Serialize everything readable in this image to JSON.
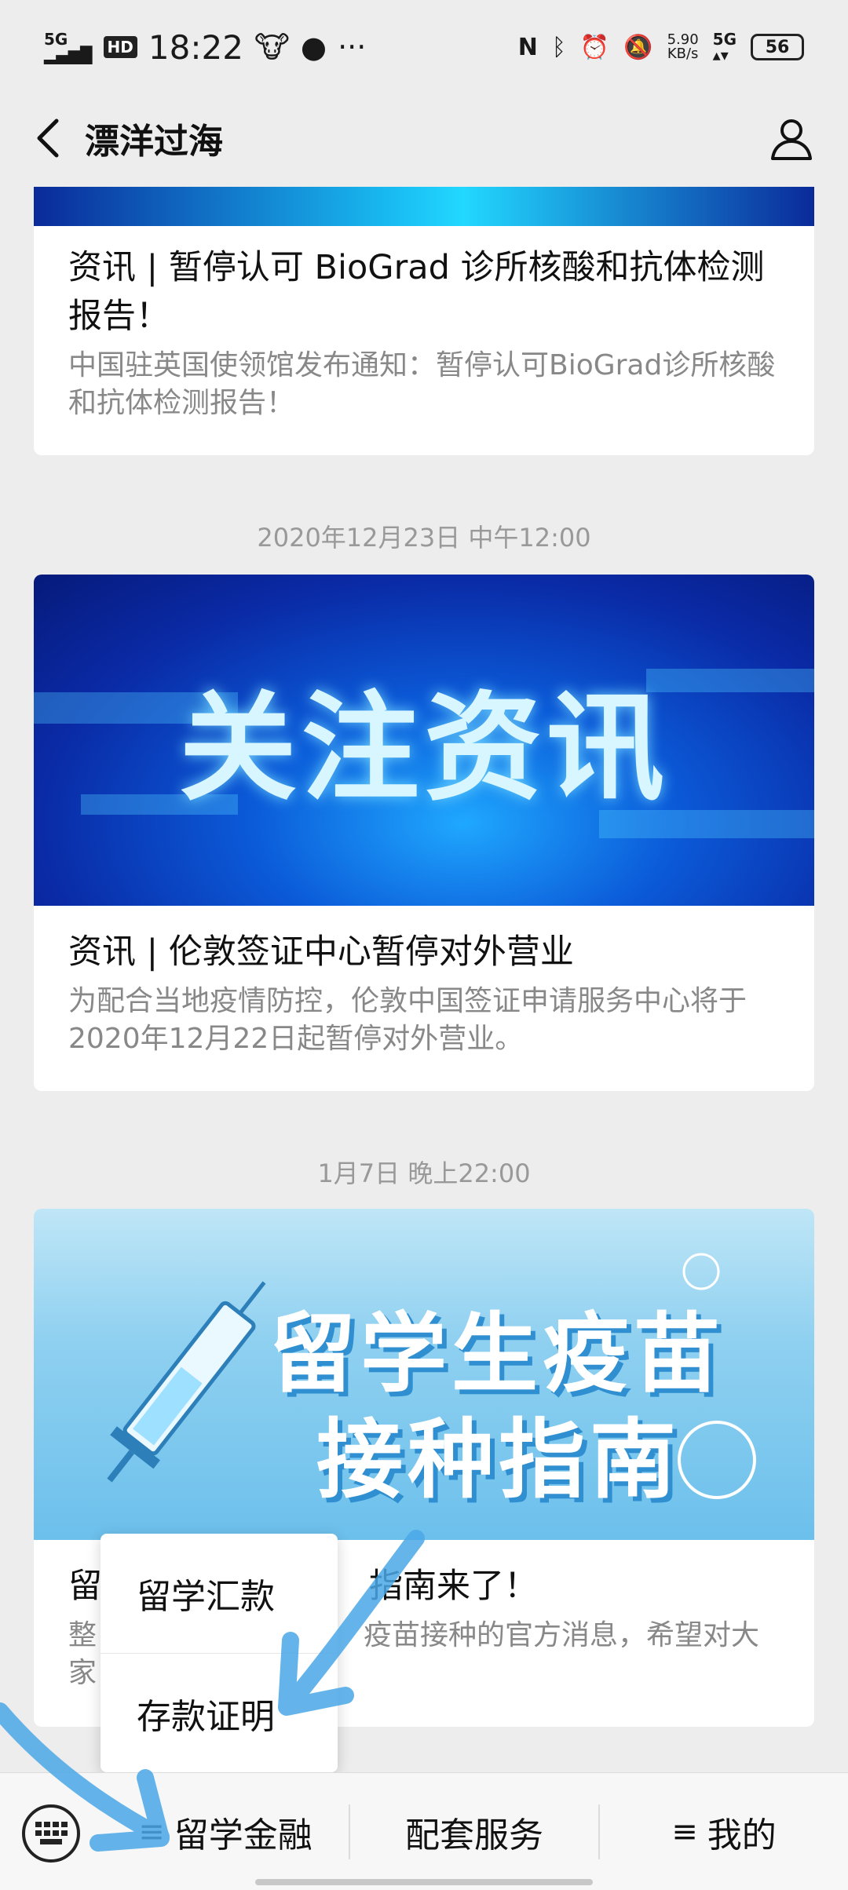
{
  "status_bar": {
    "network_type": "5G",
    "time": "18:22",
    "speed_value": "5.90",
    "speed_unit": "KB/s",
    "network_type_2": "5G",
    "battery": "56"
  },
  "nav": {
    "title": "漂洋过海"
  },
  "feed": [
    {
      "title": "资讯 | 暂停认可 BioGrad 诊所核酸和抗体检测报告！",
      "desc": "中国驻英国使领馆发布通知：暂停认可BioGrad诊所核酸和抗体检测报告！"
    },
    {
      "timestamp": "2020年12月23日 中午12:00",
      "banner_text": "关注资讯",
      "title": "资讯 | 伦敦签证中心暂停对外营业",
      "desc": "为配合当地疫情防控，伦敦中国签证申请服务中心将于2020年12月22日起暂停对外营业。"
    },
    {
      "timestamp": "1月7日 晚上22:00",
      "banner_line1": "留学生疫苗",
      "banner_line2": "接种指南",
      "title_start": "留",
      "title_end": "指南来了！",
      "desc_line1_start": "整",
      "desc_line1_end": "疫苗接种的官方消息，希望对大",
      "desc_line2_start": "家"
    }
  ],
  "popup_menu": {
    "items": [
      "留学汇款",
      "存款证明"
    ]
  },
  "bottom_menu": {
    "tab1": "留学金融",
    "tab2": "配套服务",
    "tab3": "我的"
  },
  "colors": {
    "background": "#ededed",
    "card": "#ffffff",
    "annotation_arrow": "#4aa8e8"
  }
}
